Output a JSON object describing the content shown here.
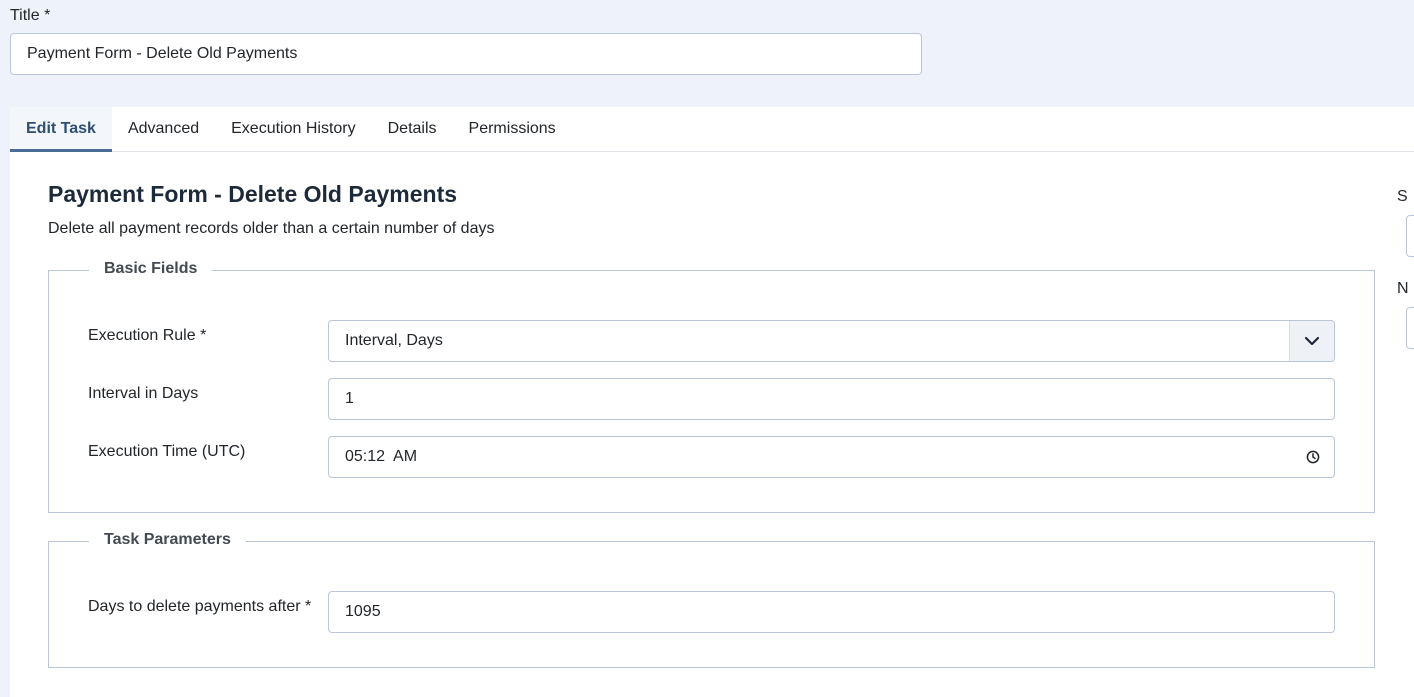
{
  "title": {
    "label": "Title *",
    "value": "Payment Form - Delete Old Payments"
  },
  "tabs": [
    {
      "label": "Edit Task",
      "active": true
    },
    {
      "label": "Advanced",
      "active": false
    },
    {
      "label": "Execution History",
      "active": false
    },
    {
      "label": "Details",
      "active": false
    },
    {
      "label": "Permissions",
      "active": false
    }
  ],
  "task": {
    "heading": "Payment Form - Delete Old Payments",
    "description": "Delete all payment records older than a certain number of days"
  },
  "basic_fields": {
    "legend": "Basic Fields",
    "execution_rule": {
      "label": "Execution Rule *",
      "value": "Interval, Days",
      "icon": "chevron-down-icon"
    },
    "interval_days": {
      "label": "Interval in Days",
      "value": "1"
    },
    "execution_time": {
      "label": "Execution Time (UTC)",
      "value": "05:12  AM",
      "icon": "clock-icon"
    }
  },
  "task_parameters": {
    "legend": "Task Parameters",
    "days_delete": {
      "label": "Days to delete payments after *",
      "value": "1095"
    }
  },
  "side_column": {
    "label_1": "S",
    "label_2": "N"
  },
  "colors": {
    "page_bg": "#eef3fb",
    "active_tab": "#2f4f72",
    "tab_underline": "#4a6b95",
    "border": "#b9c6d6"
  }
}
